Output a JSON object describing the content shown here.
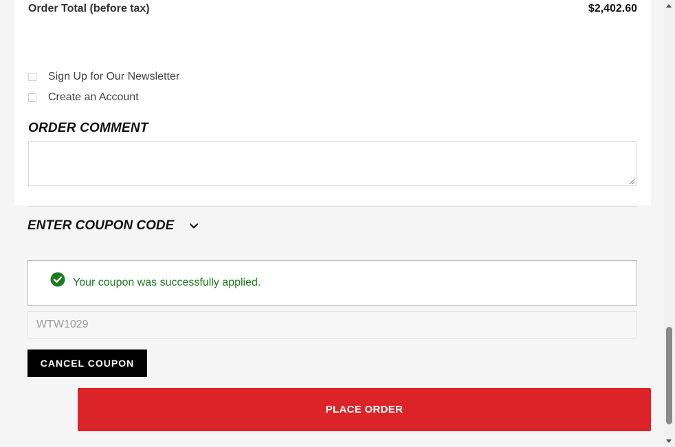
{
  "order_total": {
    "label": "Order Total (before tax)",
    "value": "$2,402.60"
  },
  "options": {
    "newsletter_label": "Sign Up for Our Newsletter",
    "account_label": "Create an Account"
  },
  "order_comment": {
    "heading": "ORDER COMMENT",
    "value": ""
  },
  "coupon": {
    "toggle_label": "ENTER COUPON CODE",
    "success_message": "Your coupon was successfully applied.",
    "code_value": "WTW1029",
    "cancel_label": "CANCEL COUPON"
  },
  "place_order_label": "PLACE ORDER",
  "colors": {
    "place_order_bg": "#dc2328",
    "success_green": "#1e7b1e",
    "cancel_bg": "#000000"
  },
  "icons": {
    "success": "check-circle-icon",
    "toggle": "chevron-down-icon"
  }
}
